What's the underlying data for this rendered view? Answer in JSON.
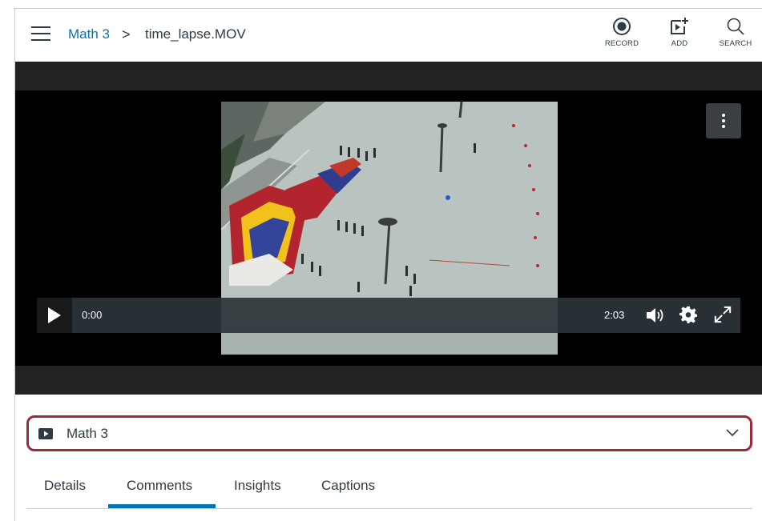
{
  "breadcrumb": {
    "course": "Math 3",
    "separator": ">",
    "current": "time_lapse.MOV"
  },
  "toolbar": {
    "record_label": "RECORD",
    "add_label": "ADD",
    "search_label": "SEARCH"
  },
  "player": {
    "current_time": "0:00",
    "duration": "2:03",
    "progress": 0
  },
  "media_selector": {
    "selected": "Math 3"
  },
  "tabs": [
    {
      "label": "Details",
      "active": false
    },
    {
      "label": "Comments",
      "active": true
    },
    {
      "label": "Insights",
      "active": false
    },
    {
      "label": "Captions",
      "active": false
    }
  ],
  "colors": {
    "link": "#0374b5",
    "selector_border": "#9b2c3b",
    "tab_active": "#0374b5"
  }
}
